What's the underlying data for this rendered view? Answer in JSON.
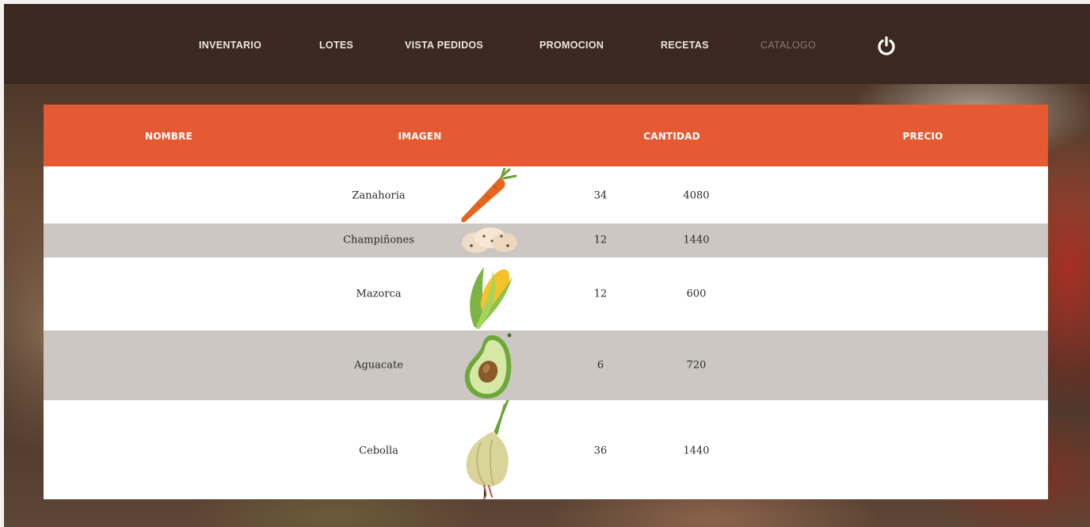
{
  "nav": {
    "items": [
      {
        "label": "INVENTARIO",
        "active": false
      },
      {
        "label": "LOTES",
        "active": false
      },
      {
        "label": "VISTA PEDIDOS",
        "active": false
      },
      {
        "label": "PROMOCION",
        "active": false
      },
      {
        "label": "RECETAS",
        "active": false
      },
      {
        "label": "CATALOGO",
        "active": true
      }
    ],
    "power_icon": "power-icon"
  },
  "table": {
    "headers": [
      "NOMBRE",
      "IMAGEN",
      "CANTIDAD",
      "PRECIO"
    ],
    "rows": [
      {
        "nombre": "Zanahoria",
        "imagen": "carrot-icon",
        "cantidad": "34",
        "precio": "4080"
      },
      {
        "nombre": "Champiñones",
        "imagen": "mushrooms-icon",
        "cantidad": "12",
        "precio": "1440"
      },
      {
        "nombre": "Mazorca",
        "imagen": "corn-icon",
        "cantidad": "12",
        "precio": "600"
      },
      {
        "nombre": "Aguacate",
        "imagen": "avocado-icon",
        "cantidad": "6",
        "precio": "720"
      },
      {
        "nombre": "Cebolla",
        "imagen": "onion-icon",
        "cantidad": "36",
        "precio": "1440"
      }
    ]
  },
  "colors": {
    "navbar": "#3b2820",
    "header": "#e55a32",
    "row_alt": "#ccc7c2",
    "row_plain": "#ffffff"
  }
}
